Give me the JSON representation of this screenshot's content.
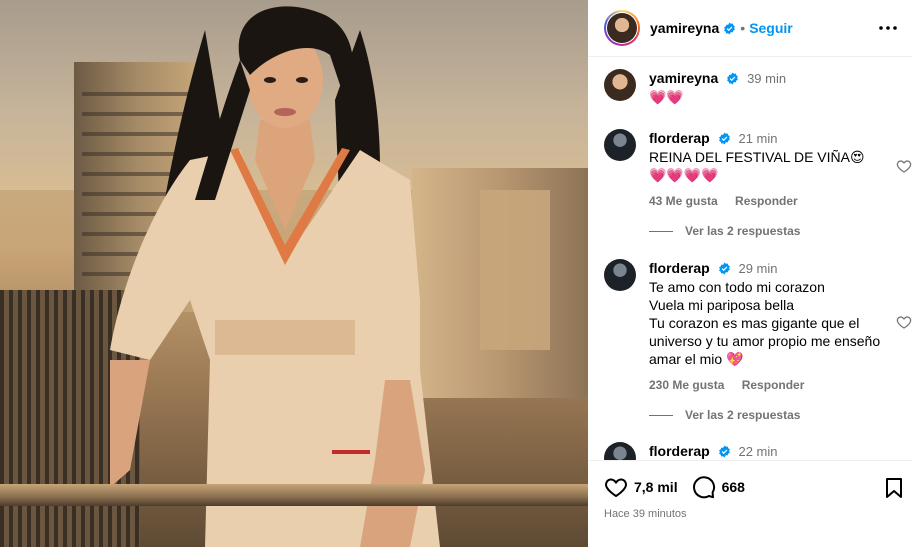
{
  "post": {
    "username": "yamireyna",
    "follow_label": "Seguir",
    "separator": "•"
  },
  "caption": {
    "username": "yamireyna",
    "time": "39 min",
    "text": "💗💗"
  },
  "comments": [
    {
      "username": "flordерap",
      "time": "21 min",
      "text": "REINA DEL FESTIVAL DE VIÑA😍\n💗💗💗💗",
      "likes": "43 Me gusta",
      "reply_label": "Responder",
      "view_replies": "Ver las 2 respuestas"
    },
    {
      "username": "florderap",
      "time": "29 min",
      "text": "Te amo con todo mi corazon\nVuela mi pariposa bella\nTu corazon es mas gigante que el universo y tu amor propio me enseño amar el mio 💖",
      "likes": "230 Me gusta",
      "reply_label": "Responder",
      "view_replies": "Ver las 2 respuestas"
    },
    {
      "username": "florderap",
      "time": "22 min"
    }
  ],
  "footer": {
    "likes_count": "7,8 mil",
    "comments_count": "668",
    "posted_ago": "Hace 39 minutos"
  },
  "colors": {
    "accent": "#0095f6",
    "verified": "#0095f6",
    "muted": "#737373"
  }
}
